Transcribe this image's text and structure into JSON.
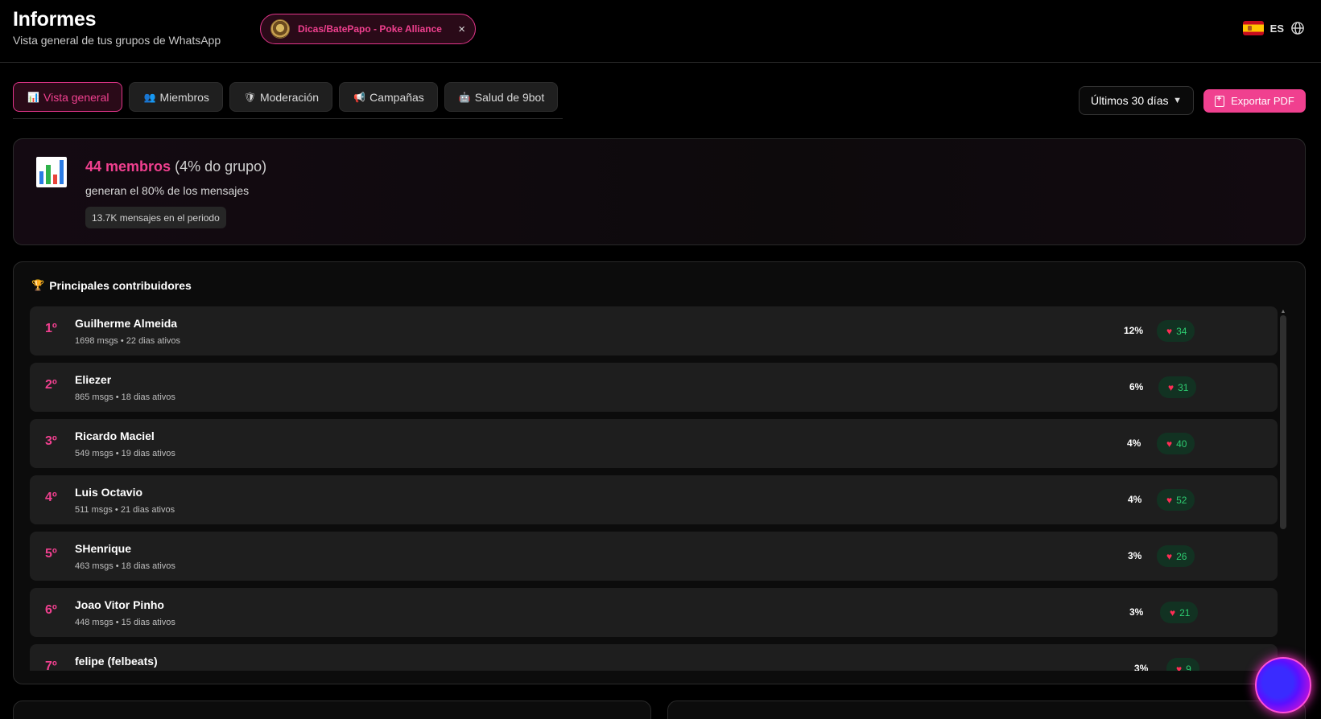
{
  "header": {
    "title": "Informes",
    "subtitle": "Vista general de tus grupos de WhatsApp",
    "group_name": "Dicas/BatePapo - Poke Alliance",
    "close_glyph": "×",
    "language_code": "ES",
    "flag_icon": "spain-flag-icon",
    "language_icon": "globe-icon"
  },
  "tabs": [
    {
      "icon": "📊",
      "label": "Vista general",
      "active": true
    },
    {
      "icon": "👥",
      "label": "Miembros",
      "active": false
    },
    {
      "icon": "🛡",
      "label": "Moderación",
      "active": false
    },
    {
      "icon": "📢",
      "label": "Campañas",
      "active": false
    },
    {
      "icon": "🤖",
      "label": "Salud de 9bot",
      "active": false
    }
  ],
  "toolbar": {
    "period_label": "Últimos 30 días",
    "export_label": "Exportar PDF"
  },
  "summary": {
    "count_label": "44 membros",
    "pct_label": "(4% do grupo)",
    "description": "generan el 80% de los mensajes",
    "badge": "13.7K mensajes en el periodo"
  },
  "contributors": {
    "title": "Principales contribuidores",
    "rows": [
      {
        "rank": "1º",
        "name": "Guilherme Almeida",
        "meta": "1698 msgs • 22 dias ativos",
        "pct": "12%",
        "likes": "34"
      },
      {
        "rank": "2º",
        "name": "Eliezer",
        "meta": "865 msgs • 18 dias ativos",
        "pct": "6%",
        "likes": "31"
      },
      {
        "rank": "3º",
        "name": "Ricardo Maciel",
        "meta": "549 msgs • 19 dias ativos",
        "pct": "4%",
        "likes": "40"
      },
      {
        "rank": "4º",
        "name": "Luis Octavio",
        "meta": "511 msgs • 21 dias ativos",
        "pct": "4%",
        "likes": "52"
      },
      {
        "rank": "5º",
        "name": "SHenrique",
        "meta": "463 msgs • 18 dias ativos",
        "pct": "3%",
        "likes": "26"
      },
      {
        "rank": "6º",
        "name": "Joao Vitor Pinho",
        "meta": "448 msgs • 15 dias ativos",
        "pct": "3%",
        "likes": "21"
      },
      {
        "rank": "7º",
        "name": "felipe (felbeats)",
        "meta": "",
        "pct": "3%",
        "likes": "9"
      }
    ]
  },
  "colors": {
    "accent": "#f0408f",
    "like_text": "#2ecc71",
    "heart": "#ff2d55"
  }
}
